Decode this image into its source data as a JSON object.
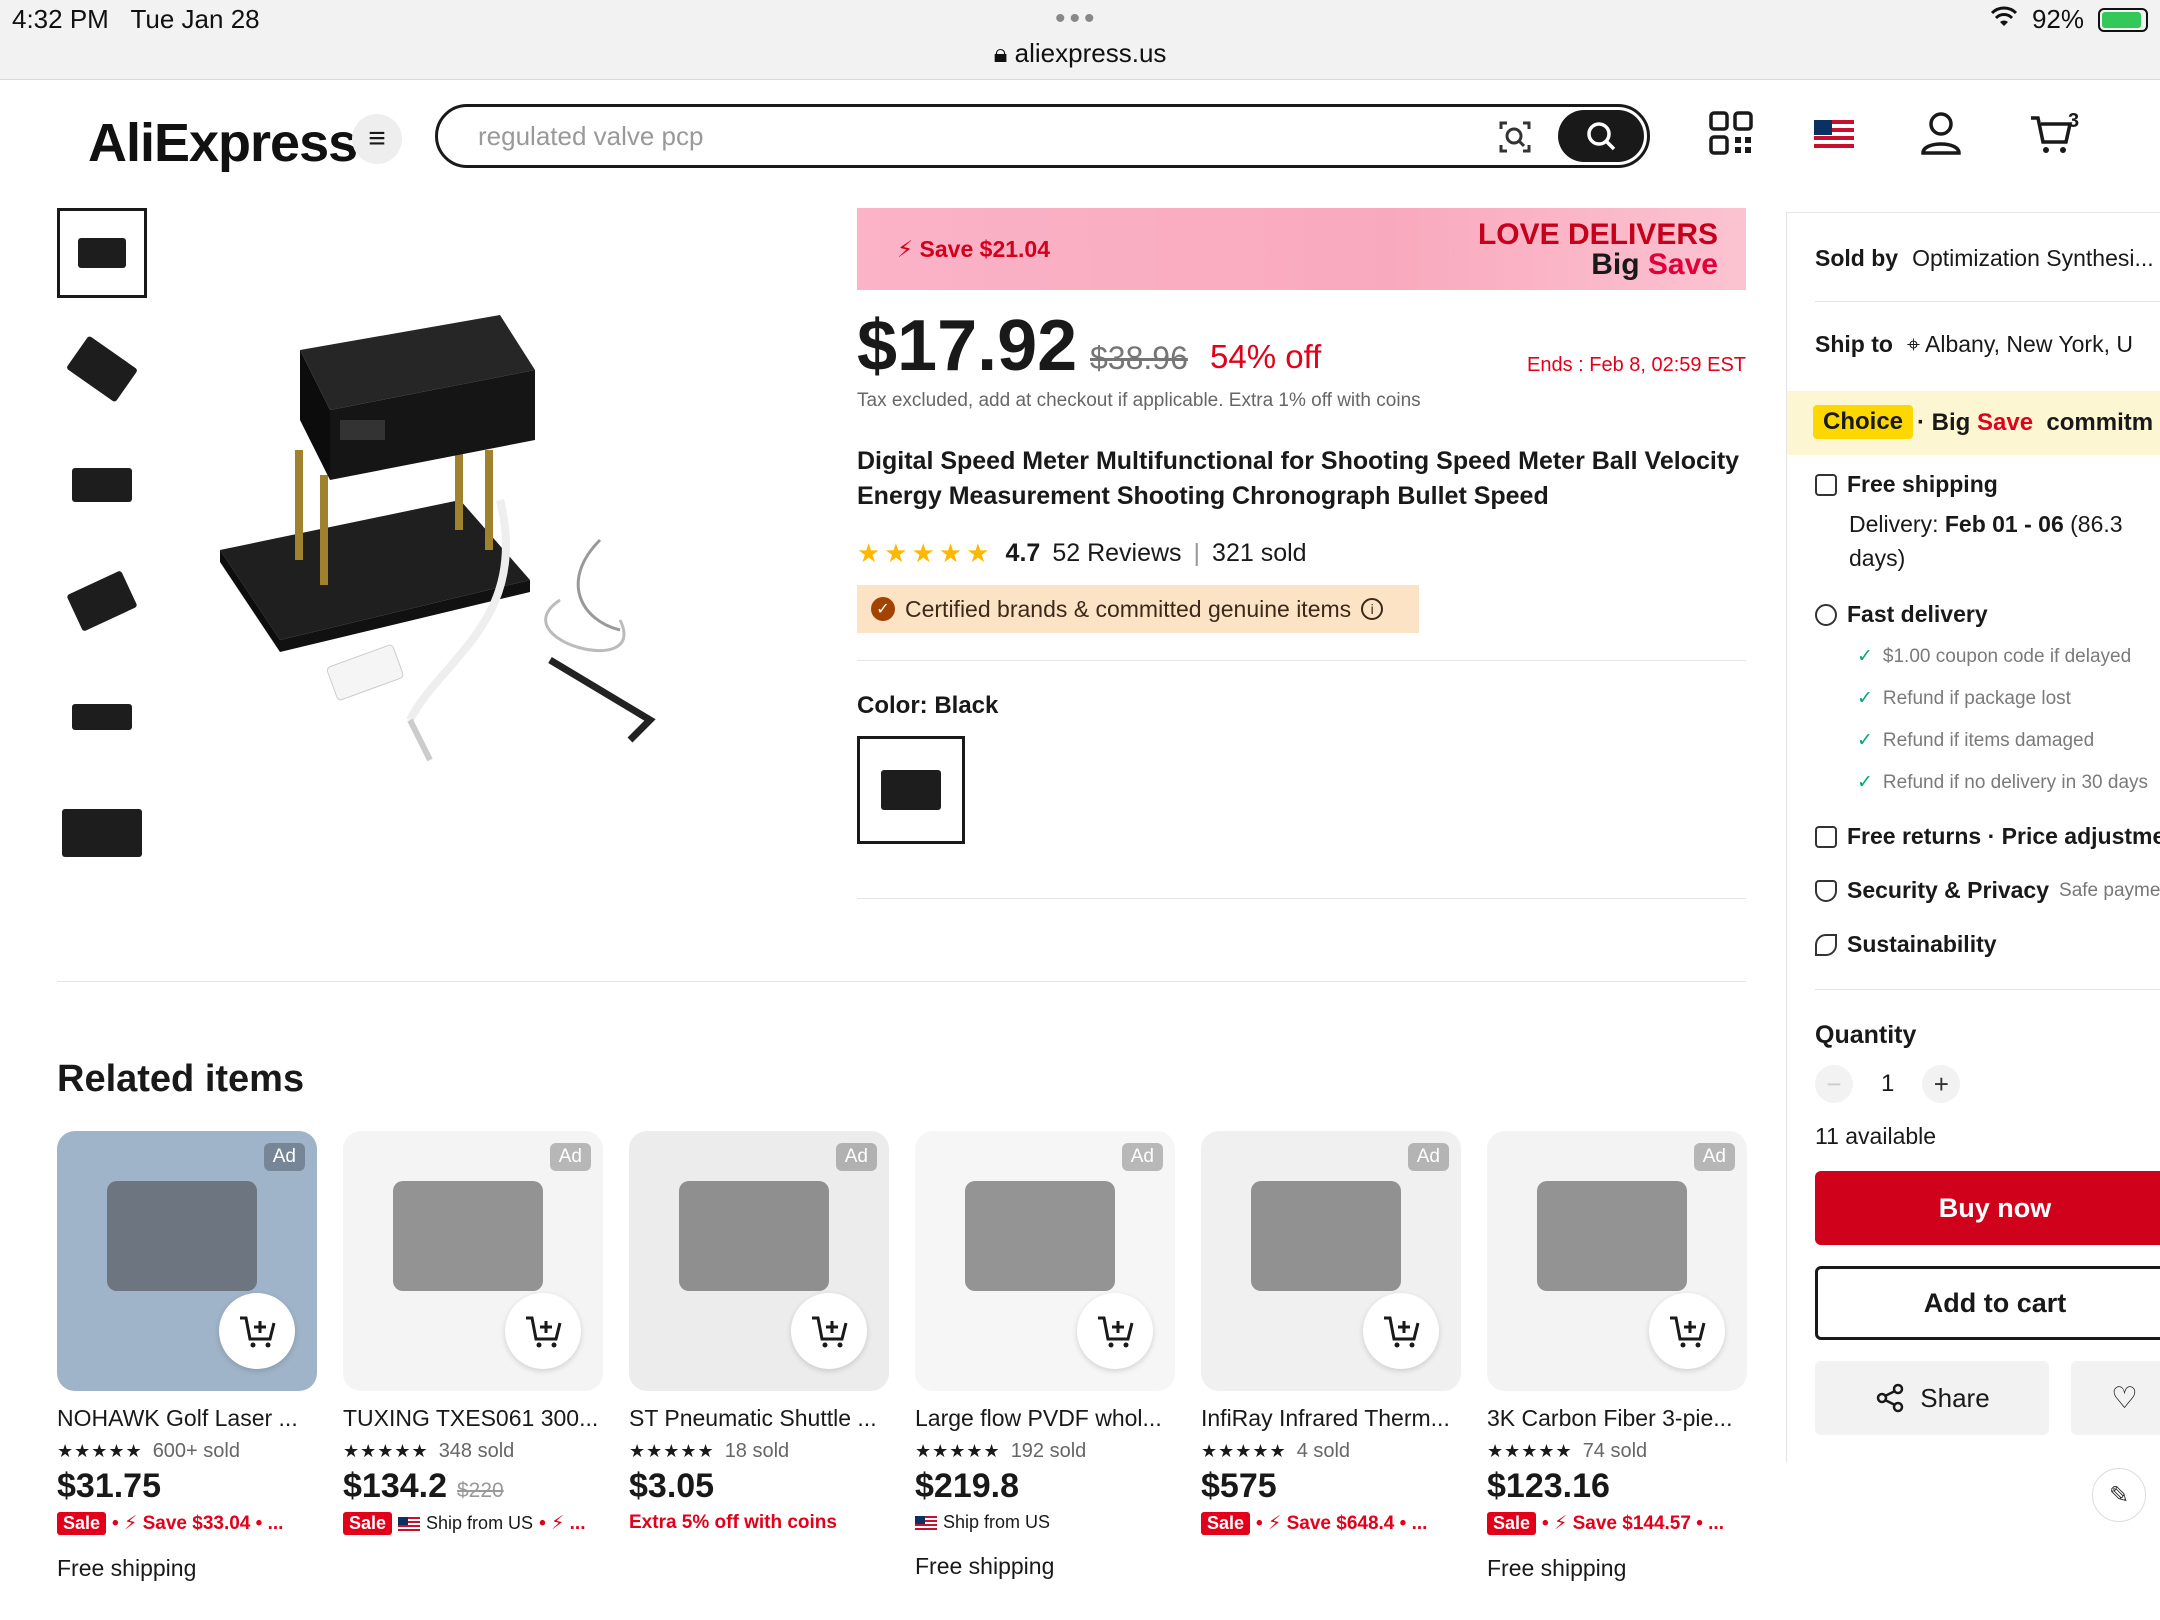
{
  "status_bar": {
    "time": "4:32 PM",
    "date": "Tue Jan 28",
    "url": "aliexpress.us",
    "battery": "92%",
    "battery_level": 0.92
  },
  "header": {
    "logo": "AliExpress",
    "search_placeholder": "regulated valve pcp",
    "cart_count": "3"
  },
  "promo": {
    "save": "Save $21.04",
    "love": "LOVE DELIVERS",
    "big": "Big",
    "save_word": "Save"
  },
  "product": {
    "price": "$17.92",
    "old_price": "$38.96",
    "discount": "54% off",
    "ends": "Ends :  Feb 8, 02:59 EST",
    "tax_note": "Tax excluded, add at checkout if applicable. Extra 1% off with coins",
    "title": "Digital Speed Meter Multifunctional for Shooting Speed Meter Ball Velocity Energy Measurement Shooting Chronograph Bullet Speed",
    "stars": "★★★★★",
    "rating": "4.7",
    "reviews": "52 Reviews",
    "sold": "321 sold",
    "certified": "Certified brands & committed genuine items",
    "color_label": "Color: Black"
  },
  "sidebar": {
    "sold_by_label": "Sold by",
    "sold_by_value": "Optimization Synthesi...",
    "ship_to_label": "Ship to",
    "ship_to_value": "Albany, New York, U",
    "choice_tag": "Choice",
    "choice_sep": "·",
    "choice_big": "Big",
    "choice_save": "Save",
    "choice_commit": "commitm",
    "free_shipping": "Free shipping",
    "delivery_label": "Delivery:",
    "delivery_value": "Feb 01 - 06",
    "delivery_pct": "(86.3",
    "delivery_days": "days)",
    "fast_delivery": "Fast delivery",
    "checks": [
      "$1.00 coupon code if delayed",
      "Refund if package lost",
      "Refund if items damaged",
      "Refund if no delivery in 30 days"
    ],
    "free_returns": "Free returns · Price adjustme",
    "security": "Security & Privacy",
    "security_sub": "Safe paymen",
    "sustainability": "Sustainability",
    "quantity_label": "Quantity",
    "quantity": "1",
    "minus": "−",
    "plus": "+",
    "available": "11 available",
    "buy_now": "Buy now",
    "add_to_cart": "Add to cart",
    "share": "Share"
  },
  "related": {
    "title": "Related items",
    "ad_label": "Ad",
    "items": [
      {
        "name": "NOHAWK Golf Laser ...",
        "stars": "★★★★★",
        "sold": "600+ sold",
        "price": "$31.75",
        "old": "",
        "sale": "Sale",
        "promo": "Save $33.04 • ...",
        "ship_us": "",
        "extra": "",
        "free": "Free shipping",
        "bg": "#9fb3c9"
      },
      {
        "name": "TUXING TXES061 300...",
        "stars": "★★★★★",
        "sold": "348 sold",
        "price": "$134.2",
        "old": "$220",
        "sale": "Sale",
        "promo": "...",
        "ship_us": "Ship from US",
        "extra": "",
        "free": "",
        "bg": "#f4f4f4"
      },
      {
        "name": "ST Pneumatic Shuttle ...",
        "stars": "★★★★★",
        "sold": "18 sold",
        "price": "$3.05",
        "old": "",
        "sale": "",
        "promo": "",
        "ship_us": "",
        "extra": "Extra 5% off with coins",
        "free": "",
        "bg": "#ececec"
      },
      {
        "name": "Large flow PVDF whol...",
        "stars": "★★★★★",
        "sold": "192 sold",
        "price": "$219.8",
        "old": "",
        "sale": "",
        "promo": "",
        "ship_us": "Ship from US",
        "extra": "",
        "free": "Free shipping",
        "bg": "#f6f6f6"
      },
      {
        "name": "InfiRay Infrared Therm...",
        "stars": "★★★★★",
        "sold": "4 sold",
        "price": "$575",
        "old": "",
        "sale": "Sale",
        "promo": "Save $648.4 • ...",
        "ship_us": "",
        "extra": "",
        "free": "",
        "bg": "#f0f0f0"
      },
      {
        "name": "3K Carbon Fiber 3-pie...",
        "stars": "★★★★★",
        "sold": "74 sold",
        "price": "$123.16",
        "old": "",
        "sale": "Sale",
        "promo": "Save $144.57 • ...",
        "ship_us": "",
        "extra": "",
        "free": "Free shipping",
        "bg": "#f3f3f3"
      }
    ]
  },
  "colors": {
    "accent": "#d0021b",
    "star": "#ffb800",
    "choice": "#fcd800"
  }
}
